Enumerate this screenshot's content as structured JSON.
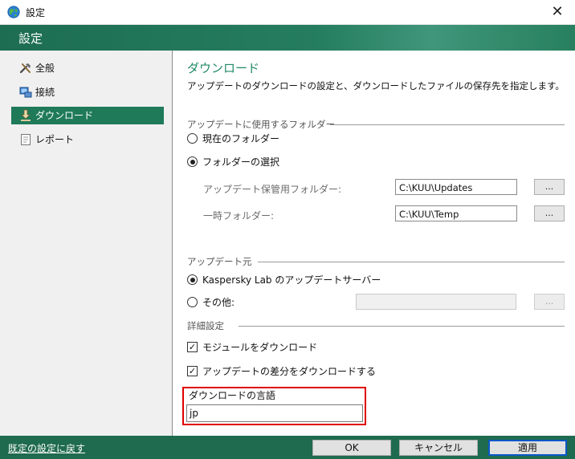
{
  "window": {
    "title": "設定",
    "close_glyph": "✕"
  },
  "header": {
    "title": "設定"
  },
  "sidebar": {
    "items": [
      {
        "label": "全般",
        "icon": "tools-icon"
      },
      {
        "label": "接続",
        "icon": "network-icon"
      },
      {
        "label": "ダウンロード",
        "icon": "download-icon",
        "active": true
      },
      {
        "label": "レポート",
        "icon": "report-icon"
      }
    ]
  },
  "main": {
    "title": "ダウンロード",
    "description": "アップデートのダウンロードの設定と、ダウンロードしたファイルの保存先を指定します。",
    "folder_group": {
      "label": "アップデートに使用するフォルダー",
      "radio_current": "現在のフォルダー",
      "radio_select": "フォルダーの選択",
      "selected": "radio_select",
      "storage_label": "アップデート保管用フォルダー:",
      "storage_value": "C:\\KUU\\Updates",
      "temp_label": "一時フォルダー:",
      "temp_value": "C:\\KUU\\Temp",
      "browse_label": "..."
    },
    "source_group": {
      "label": "アップデート元",
      "radio_kaspersky": "Kaspersky Lab のアップデートサーバー",
      "radio_other": "その他:",
      "selected": "radio_kaspersky",
      "other_value": "",
      "browse_label": "..."
    },
    "advanced_group": {
      "label": "詳細設定",
      "check_modules": "モジュールをダウンロード",
      "check_modules_checked": true,
      "check_diff": "アップデートの差分をダウンロードする",
      "check_diff_checked": true,
      "language_label": "ダウンロードの言語",
      "language_value": "jp"
    }
  },
  "footer": {
    "reset_link": "既定の設定に戻す",
    "ok": "OK",
    "cancel": "キャンセル",
    "apply": "適用"
  },
  "colors": {
    "accent": "#1f7a5a",
    "title_green": "#1f8a66",
    "highlight": "#e00000"
  }
}
